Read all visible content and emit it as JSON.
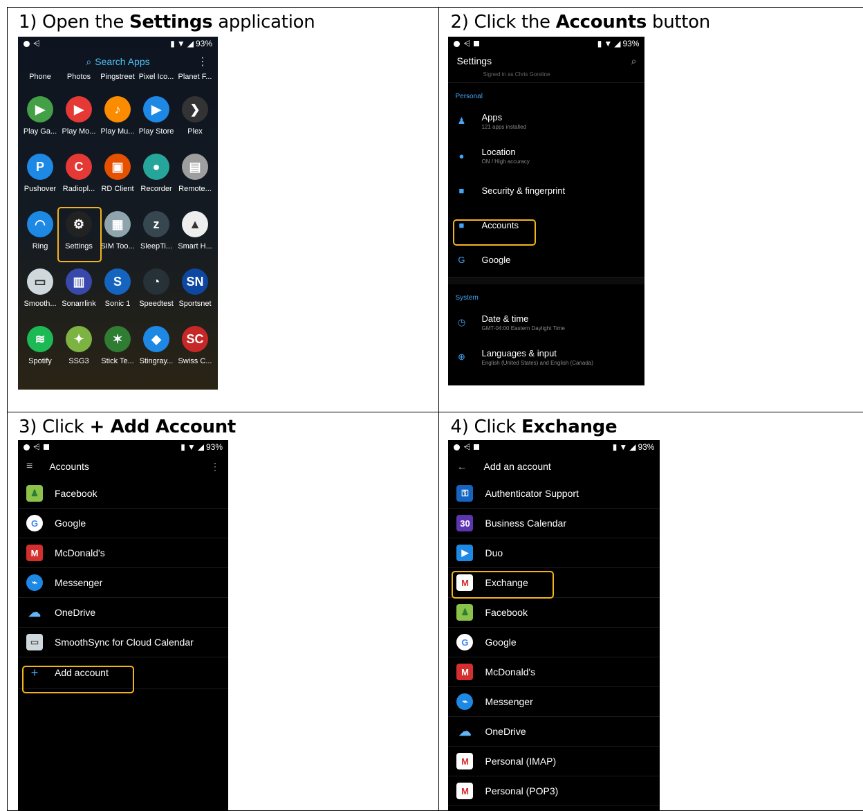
{
  "steps": {
    "s1": {
      "pre": "1)  Open the ",
      "bold": "Settings",
      "post": " application"
    },
    "s2": {
      "pre": "2)  Click the ",
      "bold": "Accounts",
      "post": " button"
    },
    "s3": {
      "pre": "3)  Click ",
      "bold": "+ Add Account",
      "post": ""
    },
    "s4": {
      "pre": "4)  Click ",
      "bold": "Exchange",
      "post": ""
    }
  },
  "status": {
    "battery": "93%"
  },
  "drawer": {
    "search_label": "Search Apps",
    "top_labels": [
      "Phone",
      "Photos",
      "Pingstreet",
      "Pixel Ico...",
      "Planet F..."
    ],
    "rows": [
      [
        {
          "label": "Play Ga...",
          "icon": "play-games-icon",
          "color": "#43a047",
          "glyph": "▶"
        },
        {
          "label": "Play Mo...",
          "icon": "play-movies-icon",
          "color": "#e53935",
          "glyph": "▶"
        },
        {
          "label": "Play Mu...",
          "icon": "play-music-icon",
          "color": "#fb8c00",
          "glyph": "♪"
        },
        {
          "label": "Play Store",
          "icon": "play-store-icon",
          "color": "#1e88e5",
          "glyph": "▶"
        },
        {
          "label": "Plex",
          "icon": "plex-icon",
          "color": "#333",
          "glyph": "❯"
        }
      ],
      [
        {
          "label": "Pushover",
          "icon": "pushover-icon",
          "color": "#1e88e5",
          "glyph": "P"
        },
        {
          "label": "Radiopl...",
          "icon": "radioplayer-icon",
          "color": "#e53935",
          "glyph": "C"
        },
        {
          "label": "RD Client",
          "icon": "rd-client-icon",
          "color": "#e65100",
          "glyph": "▣"
        },
        {
          "label": "Recorder",
          "icon": "recorder-icon",
          "color": "#26a69a",
          "glyph": "●"
        },
        {
          "label": "Remote...",
          "icon": "remote-icon",
          "color": "#9e9e9e",
          "glyph": "▤"
        }
      ],
      [
        {
          "label": "Ring",
          "icon": "ring-icon",
          "color": "#1e88e5",
          "glyph": "◠"
        },
        {
          "label": "Settings",
          "icon": "settings-gear-icon",
          "color": "#222",
          "glyph": "⚙"
        },
        {
          "label": "SIM Too...",
          "icon": "sim-toolkit-icon",
          "color": "#90a4ae",
          "glyph": "▦"
        },
        {
          "label": "SleepTi...",
          "icon": "sleep-timer-icon",
          "color": "#37474f",
          "glyph": "z"
        },
        {
          "label": "Smart H...",
          "icon": "smart-home-icon",
          "color": "#eeeeee",
          "glyph": "▲"
        }
      ],
      [
        {
          "label": "Smooth...",
          "icon": "smoothsync-icon",
          "color": "#cfd8dc",
          "glyph": "▭"
        },
        {
          "label": "Sonarrlink",
          "icon": "sonarrlink-icon",
          "color": "#3949ab",
          "glyph": "▥"
        },
        {
          "label": "Sonic 1",
          "icon": "sonic-icon",
          "color": "#1565c0",
          "glyph": "S"
        },
        {
          "label": "Speedtest",
          "icon": "speedtest-icon",
          "color": "#263238",
          "glyph": "◔"
        },
        {
          "label": "Sportsnet",
          "icon": "sportsnet-icon",
          "color": "#0d47a1",
          "glyph": "SN"
        }
      ],
      [
        {
          "label": "Spotify",
          "icon": "spotify-icon",
          "color": "#1db954",
          "glyph": "≋"
        },
        {
          "label": "SSG3",
          "icon": "ssg3-icon",
          "color": "#7cb342",
          "glyph": "✦"
        },
        {
          "label": "Stick Te...",
          "icon": "stick-tennis-icon",
          "color": "#2e7d32",
          "glyph": "✶"
        },
        {
          "label": "Stingray...",
          "icon": "stingray-icon",
          "color": "#1e88e5",
          "glyph": "◆"
        },
        {
          "label": "Swiss C...",
          "icon": "swiss-chalet-icon",
          "color": "#c62828",
          "glyph": "SC"
        }
      ]
    ]
  },
  "settings": {
    "title": "Settings",
    "signed_in": "Signed in as Chris Gorsline",
    "sections": [
      {
        "header": "Personal",
        "items": [
          {
            "label": "Apps",
            "sub": "121 apps installed",
            "icon": "android-icon",
            "glyph": "♟"
          },
          {
            "label": "Location",
            "sub": "ON / High accuracy",
            "icon": "location-pin-icon",
            "glyph": "●"
          },
          {
            "label": "Security & fingerprint",
            "sub": "",
            "icon": "lock-icon",
            "glyph": "■"
          },
          {
            "label": "Accounts",
            "sub": "",
            "icon": "account-box-icon",
            "glyph": "■"
          },
          {
            "label": "Google",
            "sub": "",
            "icon": "google-g-icon",
            "glyph": "G"
          }
        ]
      },
      {
        "header": "System",
        "items": [
          {
            "label": "Date & time",
            "sub": "GMT-04:00 Eastern Daylight Time",
            "icon": "clock-icon",
            "glyph": "◷"
          },
          {
            "label": "Languages & input",
            "sub": "English (United States) and English (Canada)",
            "icon": "globe-icon",
            "glyph": "⊕"
          }
        ]
      }
    ]
  },
  "accounts": {
    "title": "Accounts",
    "items": [
      {
        "label": "Facebook",
        "icon": "android-icon",
        "color": "#8bc34a",
        "glyph": "♟"
      },
      {
        "label": "Google",
        "icon": "google-g-icon",
        "color": "#ffffff",
        "glyph": "G"
      },
      {
        "label": "McDonald's",
        "icon": "mcdonalds-icon",
        "color": "#d32f2f",
        "glyph": "M"
      },
      {
        "label": "Messenger",
        "icon": "messenger-icon",
        "color": "#1e88e5",
        "glyph": "⌁"
      },
      {
        "label": "OneDrive",
        "icon": "onedrive-icon",
        "color": "#000",
        "glyph": "☁"
      },
      {
        "label": "SmoothSync for Cloud Calendar",
        "icon": "smoothsync-icon",
        "color": "#cfd8dc",
        "glyph": "▭"
      }
    ],
    "add_label": "Add account"
  },
  "add_account": {
    "title": "Add an account",
    "items": [
      {
        "label": "Authenticator Support",
        "icon": "authenticator-icon",
        "color": "#1565c0",
        "glyph": "⚿"
      },
      {
        "label": "Business Calendar",
        "icon": "business-calendar-icon",
        "color": "#5e35b1",
        "glyph": "30"
      },
      {
        "label": "Duo",
        "icon": "duo-icon",
        "color": "#1e88e5",
        "glyph": "▶"
      },
      {
        "label": "Exchange",
        "icon": "gmail-icon",
        "color": "#ffffff",
        "glyph": "M"
      },
      {
        "label": "Facebook",
        "icon": "android-icon",
        "color": "#8bc34a",
        "glyph": "♟"
      },
      {
        "label": "Google",
        "icon": "google-g-icon",
        "color": "#ffffff",
        "glyph": "G"
      },
      {
        "label": "McDonald's",
        "icon": "mcdonalds-icon",
        "color": "#d32f2f",
        "glyph": "M"
      },
      {
        "label": "Messenger",
        "icon": "messenger-icon",
        "color": "#1e88e5",
        "glyph": "⌁"
      },
      {
        "label": "OneDrive",
        "icon": "onedrive-icon",
        "color": "#000",
        "glyph": "☁"
      },
      {
        "label": "Personal (IMAP)",
        "icon": "gmail-icon",
        "color": "#ffffff",
        "glyph": "M"
      },
      {
        "label": "Personal (POP3)",
        "icon": "gmail-icon",
        "color": "#ffffff",
        "glyph": "M"
      }
    ]
  }
}
